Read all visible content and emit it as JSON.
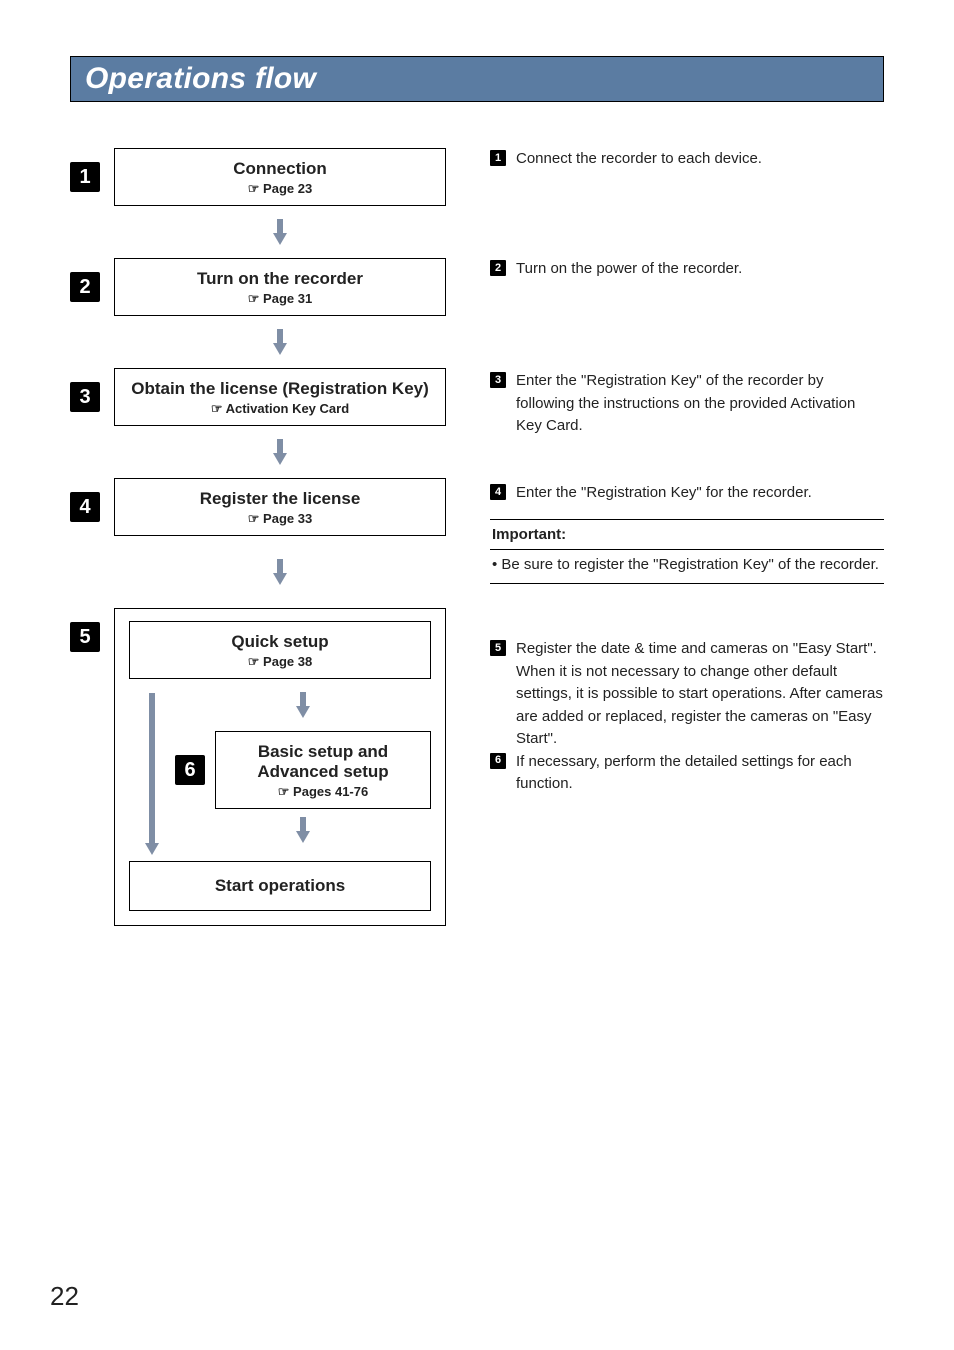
{
  "header": {
    "title": "Operations flow"
  },
  "flow": {
    "step1": {
      "num": "1",
      "title": "Connection",
      "ref": "☞ Page 23"
    },
    "step2": {
      "num": "2",
      "title": "Turn on the recorder",
      "ref": "☞ Page 31"
    },
    "step3": {
      "num": "3",
      "title": "Obtain the license (Registration Key)",
      "ref": "☞ Activation Key Card"
    },
    "step4": {
      "num": "4",
      "title": "Register the license",
      "ref": "☞ Page 33"
    },
    "step5": {
      "num": "5",
      "title": "Quick setup",
      "ref": "☞ Page 38"
    },
    "step6": {
      "num": "6",
      "title_line1": "Basic setup and",
      "title_line2": "Advanced setup",
      "ref": "☞ Pages 41-76"
    },
    "start": {
      "title": "Start operations"
    }
  },
  "descriptions": {
    "d1": "Connect the recorder to each device.",
    "d2": "Turn on the power of the recorder.",
    "d3": "Enter the \"Registration Key\" of the recorder by following the instructions on the provided Activation Key Card.",
    "d4": "Enter the \"Registration Key\" for the recorder.",
    "d5": "Register the date & time and cameras on \"Easy Start\". When it is not necessary to change other default settings, it is possible to start operations. After cameras are added or replaced, register the cameras on \"Easy Start\".",
    "d6": "If necessary, perform the detailed settings for each function."
  },
  "important": {
    "title": "Important:",
    "bullet": "Be sure to register the \"Registration Key\" of the recorder."
  },
  "page_number": "22"
}
